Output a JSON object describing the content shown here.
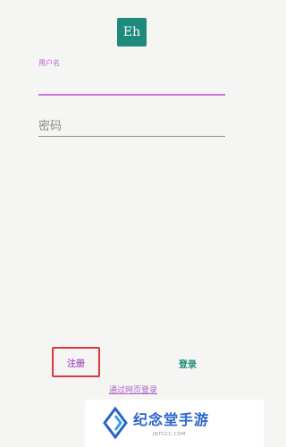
{
  "app": {
    "logo_text": "Eh",
    "brand_color": "#1e8a7c",
    "accent_color": "#c05fd1"
  },
  "form": {
    "username_label": "用户名",
    "username_value": "",
    "password_placeholder": "密码",
    "password_value": ""
  },
  "actions": {
    "register_label": "注册",
    "login_label": "登录",
    "web_login_label": "通过网页登录"
  },
  "watermark": {
    "text": "纪念堂手游",
    "subtext": "JNTCCC.COM"
  }
}
